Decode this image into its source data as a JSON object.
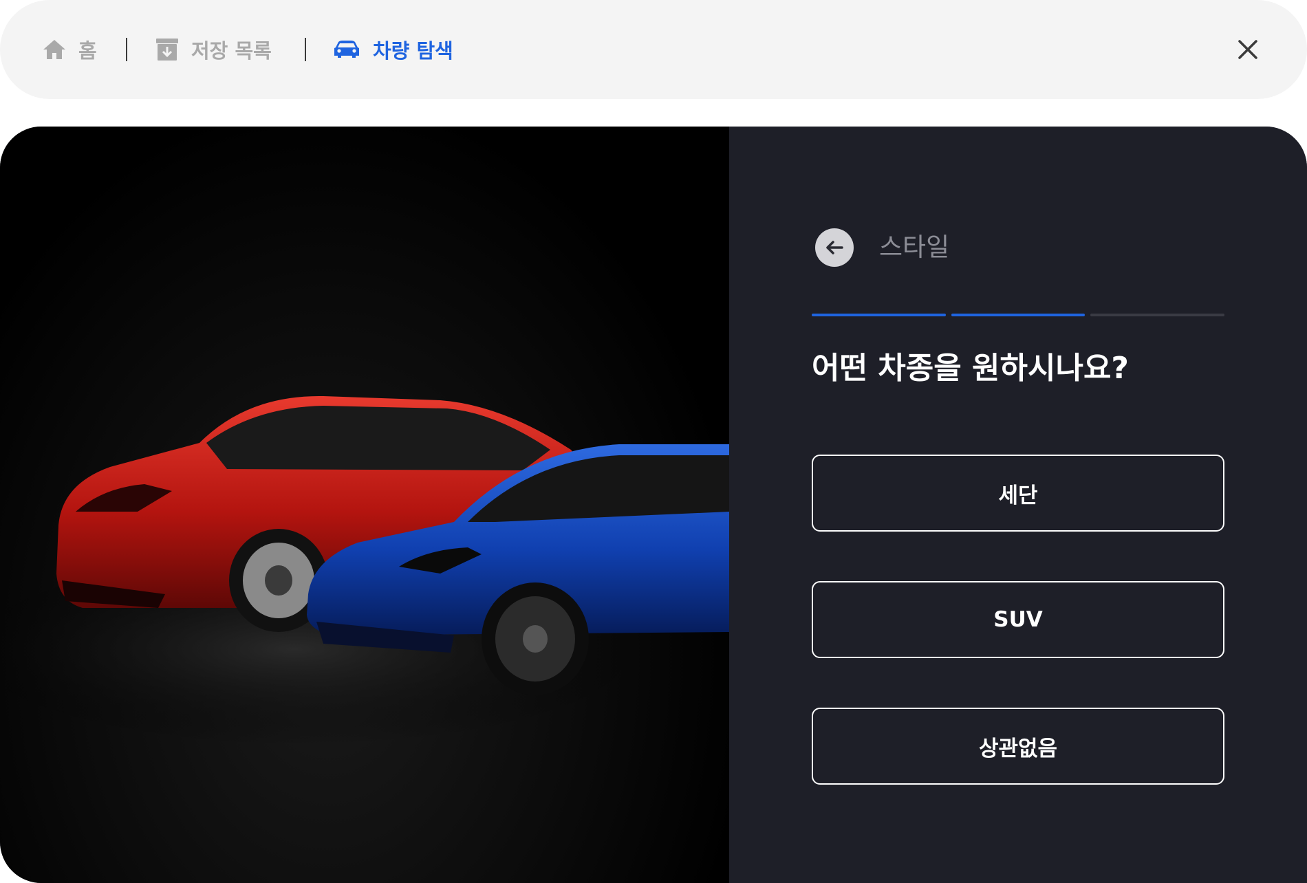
{
  "nav": {
    "home_label": "홈",
    "saved_label": "저장 목록",
    "explore_label": "차량 탐색",
    "active_color": "#1f64e0",
    "inactive_color": "#a9a9a9"
  },
  "icons": {
    "home": "home-icon",
    "saved": "archive-icon",
    "explore": "car-icon",
    "close": "close-icon",
    "back": "arrow-left-icon"
  },
  "hero": {
    "subject": "red-suv-and-blue-sedan"
  },
  "panel": {
    "step_label": "스타일",
    "progress": {
      "total_steps": 3,
      "completed_steps": 2
    },
    "question": "어떤 차종을 원하시나요?",
    "options": [
      "세단",
      "SUV",
      "상관없음"
    ]
  },
  "colors": {
    "panel_bg": "#1e1f28",
    "progress_done": "#1f64e0",
    "progress_todo": "#3a3b44"
  }
}
